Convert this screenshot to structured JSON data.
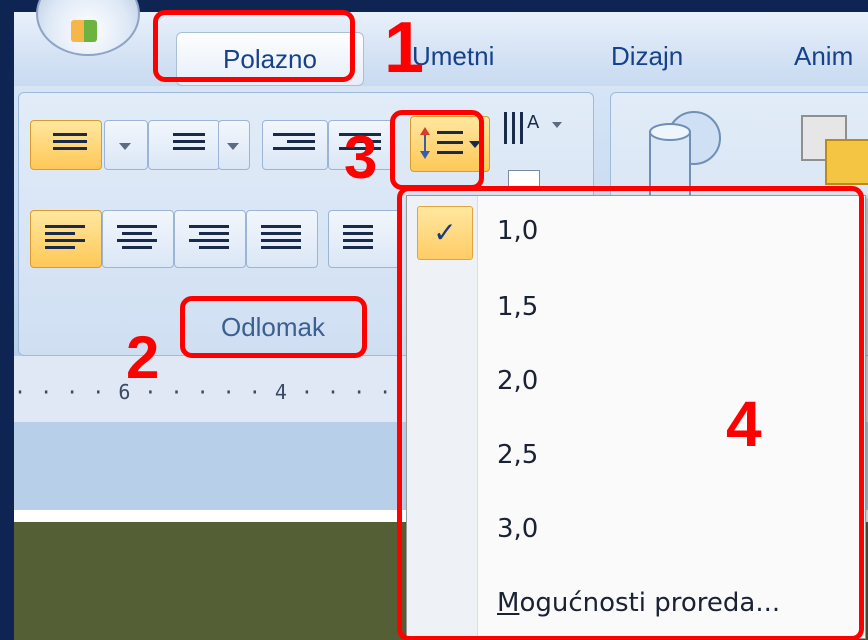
{
  "tabs": [
    "Polazno",
    "Umetni",
    "Dizajn",
    "Anim"
  ],
  "ribbon": {
    "group_label": "Odlomak"
  },
  "ruler": {
    "marks": "· · · · 6 · · · · · 4 · · · ·"
  },
  "menu": {
    "items": [
      "1,0",
      "1,5",
      "2,0",
      "2,5",
      "3,0"
    ],
    "selected": "1,0",
    "more_options_underlined": "M",
    "more_options_rest": "ogućnosti proreda..."
  },
  "icons": {
    "check": "✓"
  },
  "annotations": {
    "n1": "1",
    "n2": "2",
    "n3": "3",
    "n4": "4"
  },
  "colors": {
    "annotation": "#ff0000",
    "ribbon": "#c3d8f0",
    "active_button": "#ffc857"
  }
}
